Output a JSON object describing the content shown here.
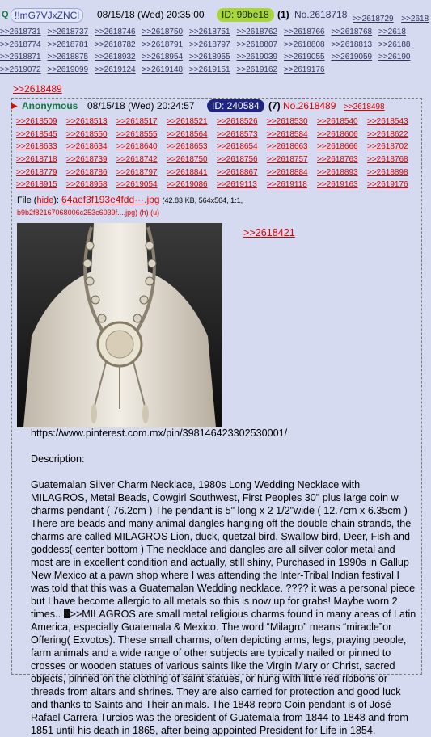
{
  "header": {
    "q_mark": "Q",
    "tripcode": "!!mG7VJxZNCl",
    "date": "08/15/18 (Wed) 20:35:00",
    "id": "ID: 99be18",
    "reply_count": "(1)",
    "post_no": "No.2618718",
    "top_links": [
      ">>2618729",
      ">>2618"
    ],
    "backlink_rows": [
      [
        ">>2618731",
        ">>2618737",
        ">>2618746",
        ">>2618750",
        ">>2618751",
        ">>2618762",
        ">>2618766",
        ">>2618768",
        ">>2618"
      ],
      [
        ">>2618774",
        ">>2618781",
        ">>2618782",
        ">>2618791",
        ">>2618797",
        ">>2618807",
        ">>2618808",
        ">>2618813",
        ">>26188"
      ],
      [
        ">>2618871",
        ">>2618875",
        ">>2618932",
        ">>2618954",
        ">>2618955",
        ">>2619039",
        ">>2619055",
        ">>2619059",
        ">>26190"
      ],
      [
        ">>2619072",
        ">>2619099",
        ">>2619124",
        ">>2619148",
        ">>2619151",
        ">>2619162",
        ">>2619176"
      ]
    ]
  },
  "reply": {
    "ref_link": ">>2618489",
    "name": "Anonymous",
    "date": "08/15/18 (Wed) 20:24:57",
    "id": "ID: 240584",
    "reply_count": "(7)",
    "post_no": "No.2618489",
    "side_link": ">>2618498",
    "backlink_rows": [
      [
        ">>2618509",
        ">>2618513",
        ">>2618517",
        ">>2618521",
        ">>2618526",
        ">>2618530",
        ">>2618540",
        ">>2618543"
      ],
      [
        ">>2618545",
        ">>2618550",
        ">>2618555",
        ">>2618564",
        ">>2618573",
        ">>2618584",
        ">>2618606",
        ">>2618622"
      ],
      [
        ">>2618633",
        ">>2618634",
        ">>2618640",
        ">>2618653",
        ">>2618654",
        ">>2618663",
        ">>2618666",
        ">>2618702"
      ],
      [
        ">>2618718",
        ">>2618739",
        ">>2618742",
        ">>2618750",
        ">>2618756",
        ">>2618757",
        ">>2618763",
        ">>2618768"
      ],
      [
        ">>2618779",
        ">>2618786",
        ">>2618797",
        ">>2618841",
        ">>2618867",
        ">>2618884",
        ">>2618893",
        ">>2618898"
      ],
      [
        ">>2618915",
        ">>2618958",
        ">>2619054",
        ">>2619086",
        ">>2619113",
        ">>2619118",
        ">>2619163",
        ">>2619176"
      ]
    ],
    "file": {
      "label": "File",
      "hide": "hide",
      "name": "64aef3f193e4fdd···.jpg",
      "meta": "(42.83 KB, 564x564, 1:1,",
      "hash": "b9b2f82167068006c253c6039f....jpg)",
      "h": "(h)",
      "u": "(u)"
    },
    "quote_link": ">>2618421",
    "url": "https://www.pinterest.com.mx/pin/398146423302530001/",
    "description_label": "Description:",
    "text_1": "Guatemalan Silver Charm Necklace, 1980s Long Wedding Necklace with MILAGROS, Metal Beads, Cowgirl Southwest, First Peoples 30\" plus large coin w charms pendant ( 76.2cm ) The pendant is 5\" long x 2 1/2\"wide ( 12.7cm x 6.35cm ) There are beads and many animal dangles hanging off the double chain strands, the charms are called MILAGROS Lion, duck, quetzal bird, Swallow bird, Deer, Fish and goddess( center bottom ) The necklace and dangles are all silver color metal and most are in excellent condition and actually, still shiny, Purchased in 1990s in Gallup New Mexico at a pawn shop where I was attending the Inter-Tribal Indian festival I was told that this was a Guatemalan Wedding necklace. ???? it was a personal piece but I have become allergic to all metals so this is now up for grabs! Maybe worn 2 times..",
    "text_2": ">>MILAGROS are small metal religious charms found in many areas of Latin America, especially Guatemala & Mexico. The word “Milagro” means “miracle”or Offering( Exvotos). These small charms, often depicting arms, legs, praying people, farm animals and a wide range of other subjects are typically nailed or pinned to crosses or wooden statues of various saints like the Virgin Mary or Christ, sacred objects, pinned on the clothing of saint statues, or hung with little red ribbons or threads from altars and shrines. They are also carried for protection and good luck and thanks to Saints and Their animals. The 1848 repro Coin pendant is of José Rafael Carrera Turcios was the president of Guatemala from 1844 to 1848 and from 1851 until his death in 1865, after being appointed President for Life in 1854."
  }
}
